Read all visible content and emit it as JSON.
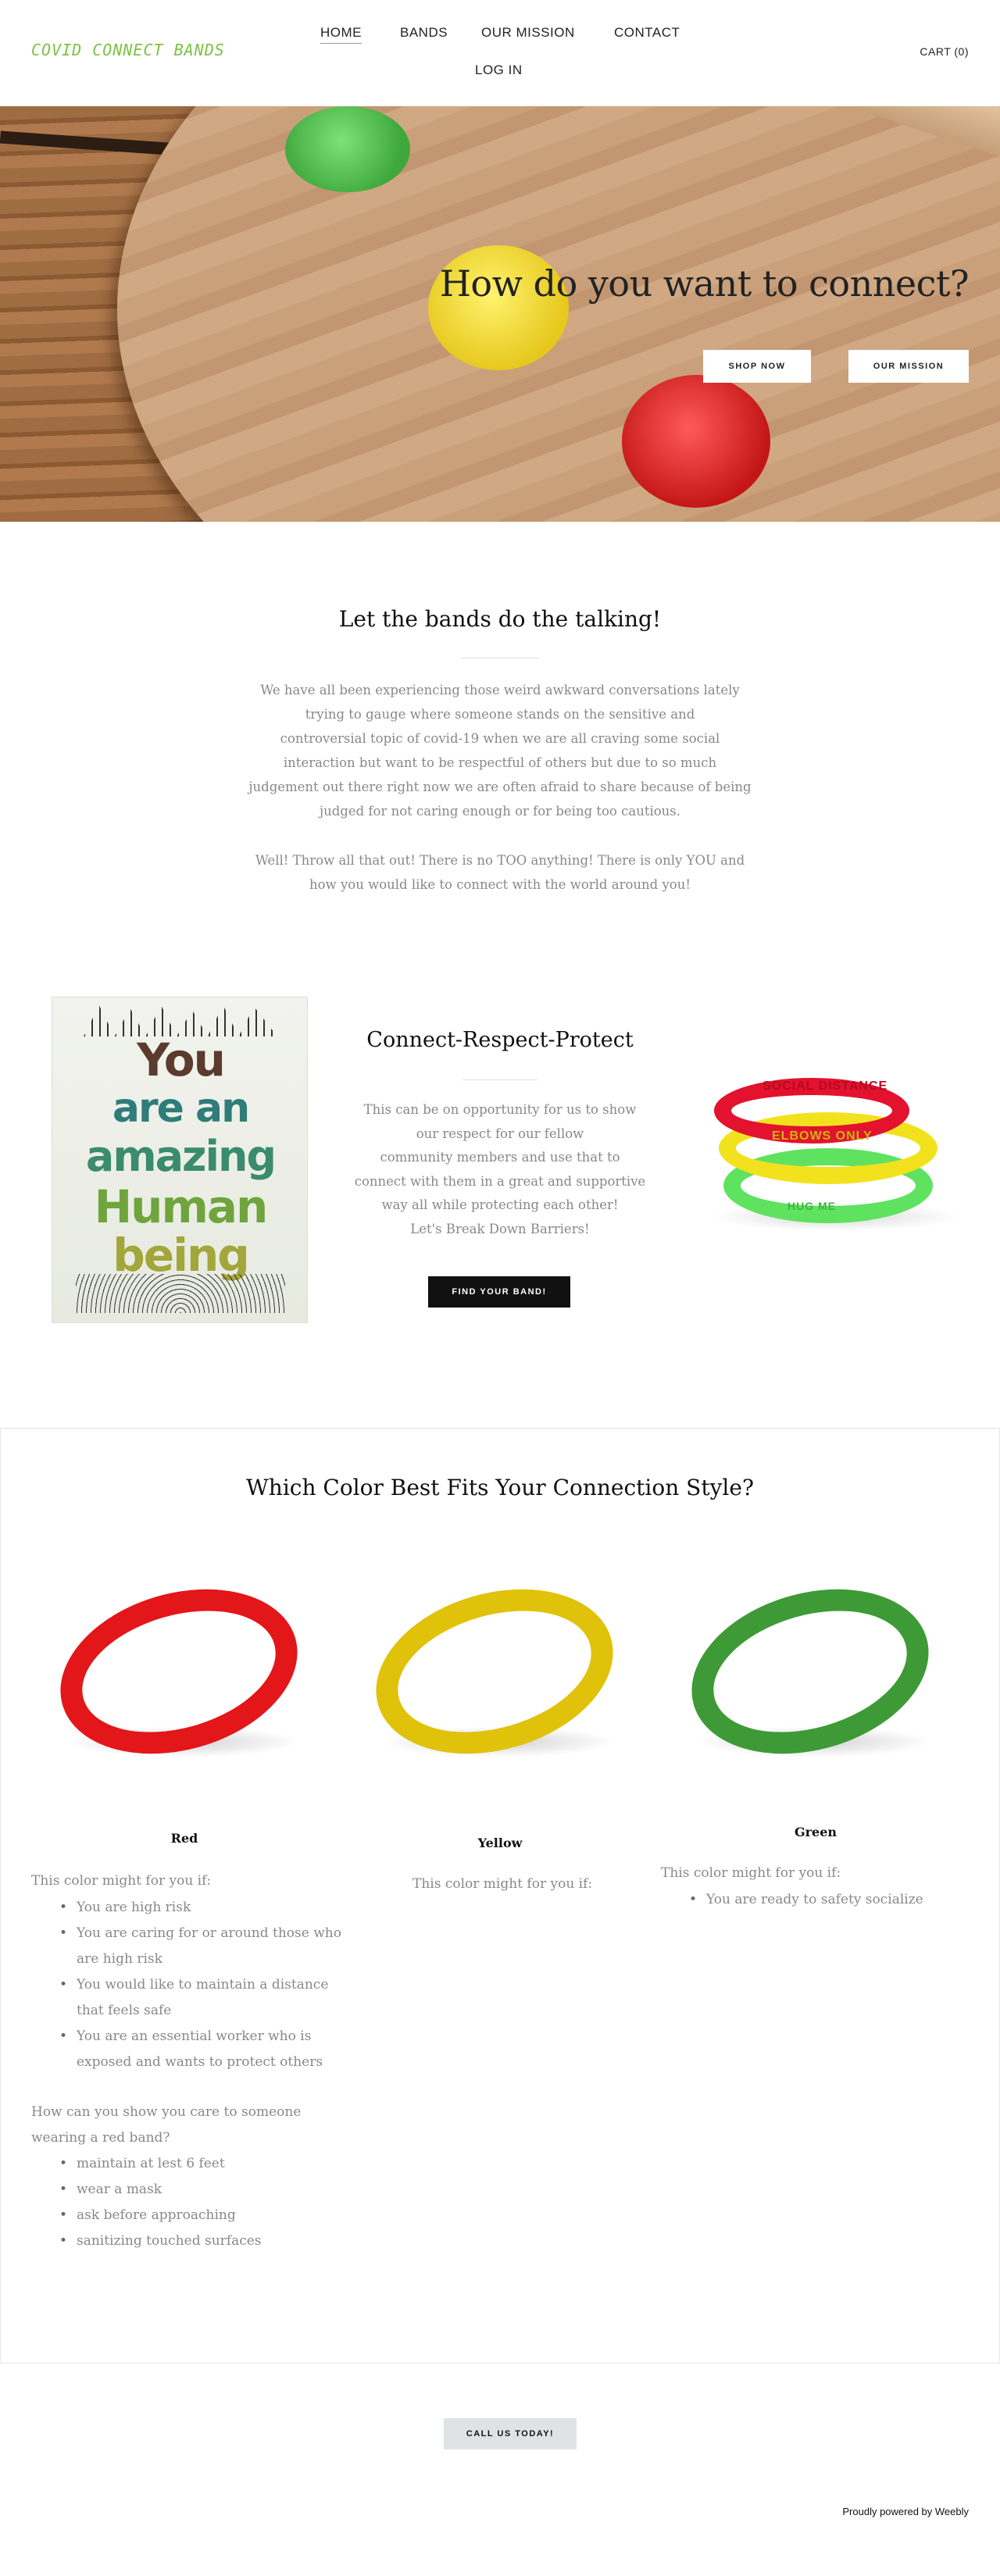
{
  "header": {
    "logo": "COVID CONNECT BANDS",
    "nav": [
      "HOME",
      "BANDS",
      "OUR MISSION",
      "CONTACT",
      "LOG IN"
    ],
    "cart": "CART (0)"
  },
  "hero": {
    "title": "How do you want to connect?",
    "shop_button": "SHOP NOW",
    "mission_button": "OUR MISSION"
  },
  "intro": {
    "title": "Let the bands do the talking!",
    "paragraph1_lines": [
      "We have all been experiencing those weird awkward conversations lately",
      "trying to gauge where someone stands on the sensitive and",
      "controversial topic of covid-19 when we are all craving some social",
      "interaction but want to be respectful of others but due to so much",
      "judgement out there right now we are often afraid to share because of being",
      "judged for not caring enough or for being too cautious."
    ],
    "paragraph2_lines": [
      "Well! Throw all that out! There is no TOO anything! There is only YOU and",
      "how you would like to connect with the world around you!"
    ]
  },
  "connect": {
    "poster_lines": [
      "You",
      "are an",
      "amazing",
      "Human",
      "being"
    ],
    "title": "Connect-Respect-Protect",
    "text_lines": [
      "This can be on opportunity for us to show",
      "our respect for our fellow",
      "community members and use that to",
      "connect with them in a great and supportive",
      "way all while protecting each other!",
      "Let's Break Down Barriers!"
    ],
    "band_texts": [
      "SOCIAL DISTANCE",
      "ELBOWS ONLY",
      "HUG ME"
    ],
    "button": "FIND YOUR BAND!"
  },
  "colors": {
    "title": "Which Color Best Fits Your Connection Style?",
    "swatches": {
      "red": "#e3161a",
      "yellow": "#e0c20a",
      "green": "#3e9a36"
    },
    "red": {
      "name": "Red",
      "intro": "This color might for you if:",
      "reasons": [
        [
          "You are high risk"
        ],
        [
          "You are caring for or around those who",
          "are high risk"
        ],
        [
          "You would like to maintain a distance",
          "that feels safe"
        ],
        [
          "You are an essential worker who is",
          "exposed and wants to protect others"
        ]
      ],
      "question_lines": [
        "How can you show you care to someone",
        "wearing a red band?"
      ],
      "tips": [
        "maintain at lest 6 feet",
        "wear a mask",
        "ask before approaching",
        "sanitizing touched surfaces"
      ]
    },
    "yellow": {
      "name": "Yellow",
      "intro": "This color might for you if:"
    },
    "green": {
      "name": "Green",
      "intro": "This color might for you if:",
      "reasons": [
        "You are ready to safety socialize"
      ]
    }
  },
  "cta": {
    "call_button": "CALL US TODAY!"
  },
  "footer": {
    "text": "Proudly powered by Weebly"
  }
}
